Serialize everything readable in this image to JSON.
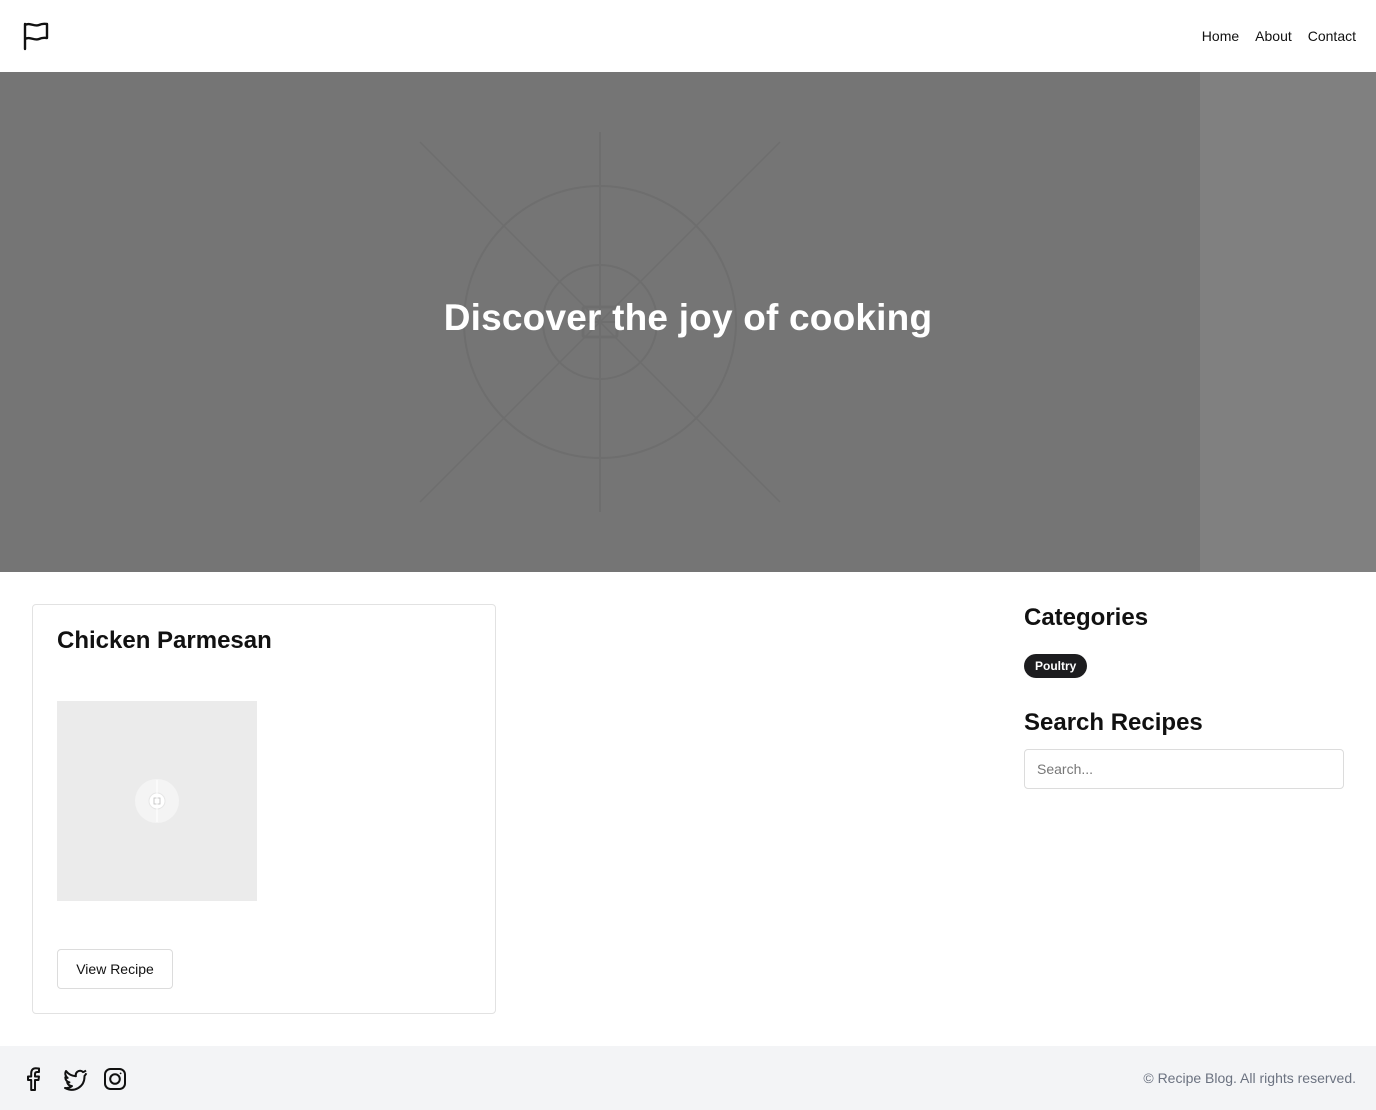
{
  "header": {
    "logo_icon": "flag-icon",
    "nav": [
      {
        "label": "Home"
      },
      {
        "label": "About"
      },
      {
        "label": "Contact"
      }
    ]
  },
  "hero": {
    "title": "Discover the joy of cooking",
    "image_icon": "image-placeholder-icon"
  },
  "recipes": [
    {
      "title": "Chicken Parmesan",
      "image_icon": "image-placeholder-icon",
      "button_label": "View Recipe"
    }
  ],
  "sidebar": {
    "categories_heading": "Categories",
    "categories": [
      "Poultry"
    ],
    "search_heading": "Search Recipes",
    "search_placeholder": "Search...",
    "search_value": ""
  },
  "footer": {
    "social_icons": [
      "facebook-icon",
      "twitter-icon",
      "instagram-icon"
    ],
    "copyright": "© Recipe Blog. All rights reserved."
  },
  "colors": {
    "hero_background": "#757575",
    "tag_background": "#1d1d1f",
    "footer_background": "#f3f4f6"
  }
}
